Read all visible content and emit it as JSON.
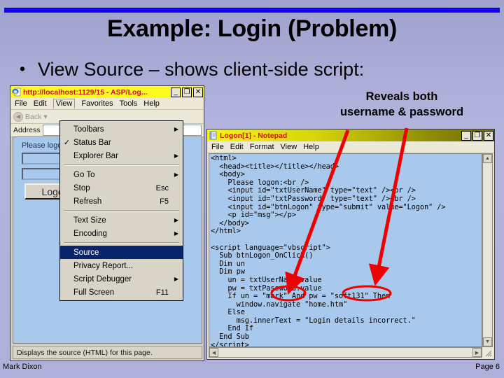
{
  "slide": {
    "title": "Example: Login (Problem)",
    "bullet": "View Source – shows client-side script:",
    "bullet_marker": "•",
    "footer_left": "Mark Dixon",
    "footer_right": "Page 6",
    "accent_rule_color": "#1100ee",
    "background_color": "#aeb0da"
  },
  "annotation": {
    "line1": "Reveals both",
    "line2": "username & password",
    "highlight_color": "#ee0000"
  },
  "browser": {
    "title": "http://localhost:1129/15 - ASP/Log...",
    "title_bg": "#fbfb1d",
    "title_fg": "#c81414",
    "buttons": {
      "minimize": "_",
      "maximize": "❐",
      "close": "✕"
    },
    "menu": [
      "File",
      "Edit",
      "View",
      "Favorites",
      "Tools",
      "Help"
    ],
    "toolbar": {
      "back_label": "Back",
      "back_arrow": "◀",
      "back_dropdown": "▾"
    },
    "address_label": "Address",
    "address_value": "",
    "page": {
      "prompt": "Please logon:",
      "username_value": "",
      "password_value": "",
      "button_label": "Logon"
    },
    "status_text": "Displays the source (HTML) for this page."
  },
  "view_menu": {
    "items": [
      {
        "label": "Toolbars",
        "checked": false,
        "accel": "",
        "submenu": true
      },
      {
        "label": "Status Bar",
        "checked": true,
        "accel": "",
        "submenu": false
      },
      {
        "label": "Explorer Bar",
        "checked": false,
        "accel": "",
        "submenu": true
      },
      {
        "separator": true
      },
      {
        "label": "Go To",
        "checked": false,
        "accel": "",
        "submenu": true
      },
      {
        "label": "Stop",
        "checked": false,
        "accel": "Esc",
        "submenu": false
      },
      {
        "label": "Refresh",
        "checked": false,
        "accel": "F5",
        "submenu": false
      },
      {
        "separator": true
      },
      {
        "label": "Text Size",
        "checked": false,
        "accel": "",
        "submenu": true
      },
      {
        "label": "Encoding",
        "checked": false,
        "accel": "",
        "submenu": true
      },
      {
        "separator": true
      },
      {
        "label": "Source",
        "checked": false,
        "accel": "",
        "submenu": false,
        "selected": true
      },
      {
        "label": "Privacy Report...",
        "checked": false,
        "accel": "",
        "submenu": false
      },
      {
        "label": "Script Debugger",
        "checked": false,
        "accel": "",
        "submenu": true
      },
      {
        "label": "Full Screen",
        "checked": false,
        "accel": "F11",
        "submenu": false
      }
    ],
    "check_glyph": "✓",
    "submenu_glyph": "▶"
  },
  "notepad": {
    "title": "Logon[1] - Notepad",
    "title_fg": "#cc1212",
    "buttons": {
      "minimize": "_",
      "maximize": "❐",
      "close": "✕"
    },
    "menu": [
      "File",
      "Edit",
      "Format",
      "View",
      "Help"
    ],
    "source": "<html>\n  <head><title></title></head>\n  <body>\n    Please logon:<br />\n    <input id=\"txtUserName\" type=\"text\" /><br />\n    <input id=\"txtPassword\" type=\"text\" /><br />\n    <input id=\"btnLogon\" type=\"submit\" value=\"Logon\" />\n    <p id=\"msg\"></p>\n  </body>\n</html>\n\n<script language=\"vbscript\">\n  Sub btnLogon_OnClick()\n  Dim un\n  Dim pw\n    un = txtUserName.value\n    pw = txtPassword.value\n    If un = \"mark\" And pw = \"soft131\" Then\n      window.navigate \"home.htm\"\n    Else\n      msg.innerText = \"Login details incorrect.\"\n    End If\n  End Sub\n</script>",
    "circled_username": "mark",
    "circled_password": "soft131",
    "scroll_glyphs": {
      "up": "▲",
      "down": "▼",
      "left": "◀",
      "right": "▶"
    }
  }
}
